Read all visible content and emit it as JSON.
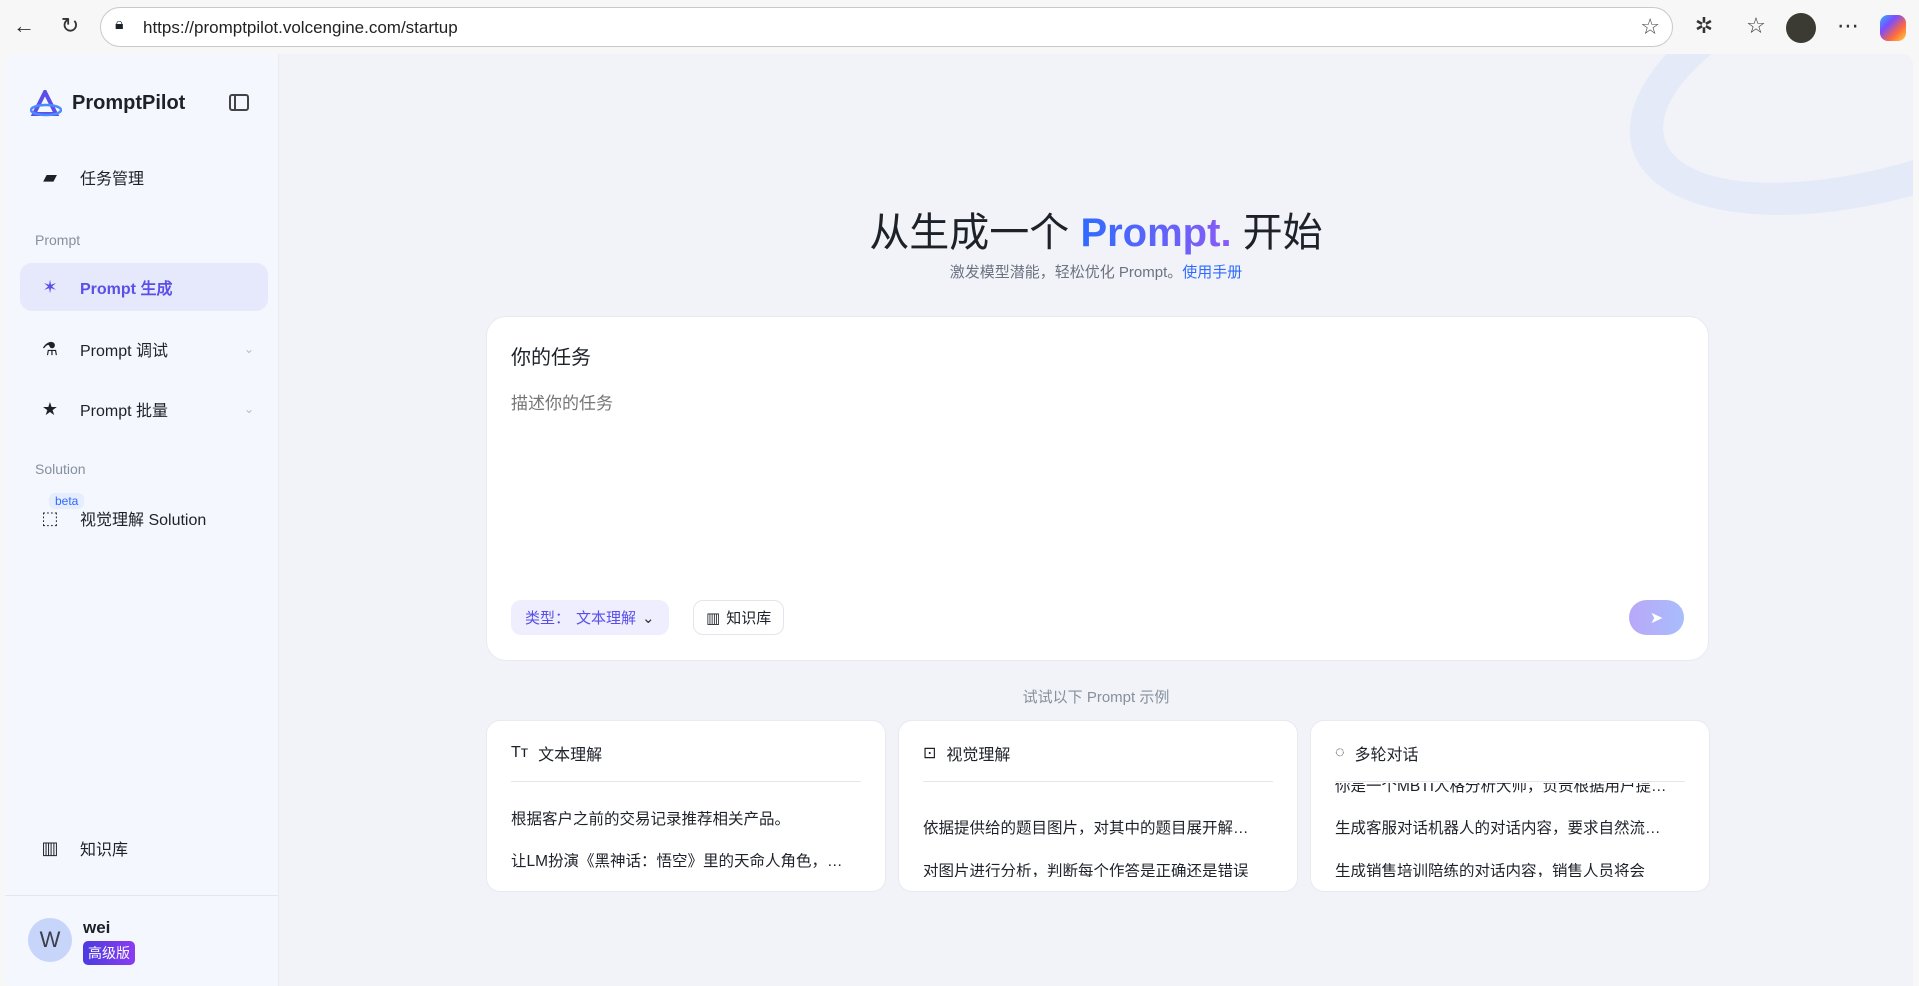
{
  "browser": {
    "url": "https://promptpilot.volcengine.com/startup"
  },
  "sidebar": {
    "brand": "PromptPilot",
    "task_mgmt": "任务管理",
    "section_prompt": "Prompt",
    "items": [
      {
        "label": "Prompt 生成",
        "active": true
      },
      {
        "label": "Prompt 调试"
      },
      {
        "label": "Prompt 批量"
      }
    ],
    "section_solution": "Solution",
    "solution_item": "视觉理解 Solution",
    "beta": "beta",
    "knowledge": "知识库",
    "user": {
      "initial": "W",
      "name": "wei",
      "plan": "高级版"
    }
  },
  "main": {
    "title_pre": "从生成一个 ",
    "title_accent": "Prompt.",
    "title_post": " 开始",
    "subtitle": "激发模型潜能，轻松优化 Prompt。",
    "manual_link": "使用手册",
    "task": {
      "label": "你的任务",
      "placeholder": "描述你的任务",
      "type_label": "类型：",
      "type_value": "文本理解",
      "knowledge_btn": "知识库"
    },
    "examples_title": "试试以下 Prompt 示例",
    "examples": [
      {
        "title": "文本理解",
        "items": [
          "根据客户之前的交易记录推荐相关产品。",
          "让LM扮演《黑神话：悟空》里的天命人角色，…"
        ]
      },
      {
        "title": "视觉理解",
        "items": [
          "依据提供给的题目图片，对其中的题目展开解…",
          "对图片进行分析，判断每个作答是正确还是错误"
        ]
      },
      {
        "title": "多轮对话",
        "items": [
          "你是一个MBTI人格分析大师，负责根据用户提…",
          "生成客服对话机器人的对话内容，要求自然流…",
          "生成销售培训陪练的对话内容，销售人员将会"
        ]
      }
    ]
  },
  "colors": {
    "accent": "#5a4fe8",
    "blue": "#2f6bff",
    "send": "#b3a9f7"
  }
}
